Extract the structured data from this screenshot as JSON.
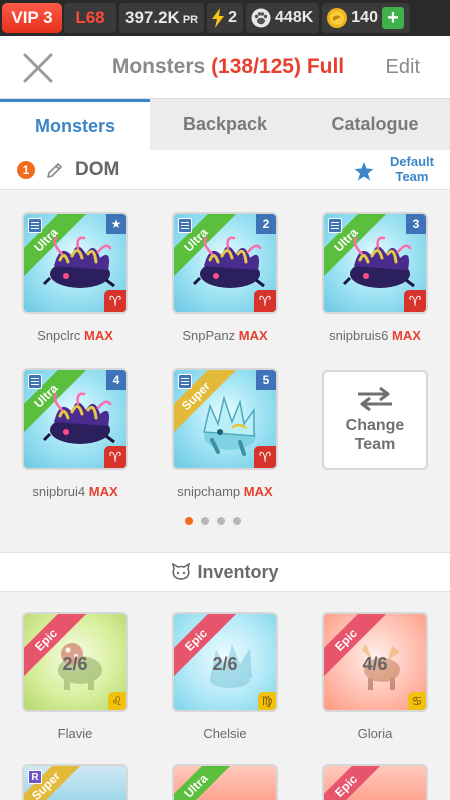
{
  "status": {
    "vip": "VIP 3",
    "level": "L68",
    "power": "397.2K",
    "power_unit": "PR",
    "energy": "2",
    "food": "448K",
    "gold": "140",
    "add": "+"
  },
  "header": {
    "title": "Monsters",
    "count": "(138/125)",
    "full": "Full",
    "edit": "Edit"
  },
  "tabs": [
    "Monsters",
    "Backpack",
    "Catalogue"
  ],
  "team": {
    "number": "1",
    "name": "DOM",
    "default_label_1": "Default",
    "default_label_2": "Team"
  },
  "monsters": [
    {
      "name": "Snpclrc",
      "max": "MAX",
      "rarity": "Ultra",
      "slot": "★",
      "element": "♈"
    },
    {
      "name": "SnpPanz",
      "max": "MAX",
      "rarity": "Ultra",
      "slot": "2",
      "element": "♈"
    },
    {
      "name": "snipbruis6",
      "max": "MAX",
      "rarity": "Ultra",
      "slot": "3",
      "element": "♈"
    },
    {
      "name": "snipbrui4",
      "max": "MAX",
      "rarity": "Ultra",
      "slot": "4",
      "element": "♈"
    },
    {
      "name": "snipchamp",
      "max": "MAX",
      "rarity": "Super",
      "slot": "5",
      "element": "♈"
    }
  ],
  "change_team": {
    "line1": "Change",
    "line2": "Team"
  },
  "inventory": {
    "title": "Inventory",
    "items": [
      {
        "name": "Flavie",
        "rarity": "Epic",
        "progress": "2/6",
        "sign": "♌",
        "theme": "green"
      },
      {
        "name": "Chelsie",
        "rarity": "Epic",
        "progress": "2/6",
        "sign": "♍",
        "theme": "blue"
      },
      {
        "name": "Gloria",
        "rarity": "Epic",
        "progress": "4/6",
        "sign": "♋",
        "theme": "red"
      }
    ],
    "peek": [
      {
        "rarity": "Super",
        "badge": "R"
      },
      {
        "rarity": "Ultra"
      },
      {
        "rarity": "Epic"
      }
    ]
  },
  "colors": {
    "accent_blue": "#3c86c8",
    "alert_red": "#e8402f",
    "orange": "#f26b1d",
    "ultra_green": "#5bbf3e",
    "super_gold": "#e3b93a",
    "epic_red": "#e6556b"
  }
}
